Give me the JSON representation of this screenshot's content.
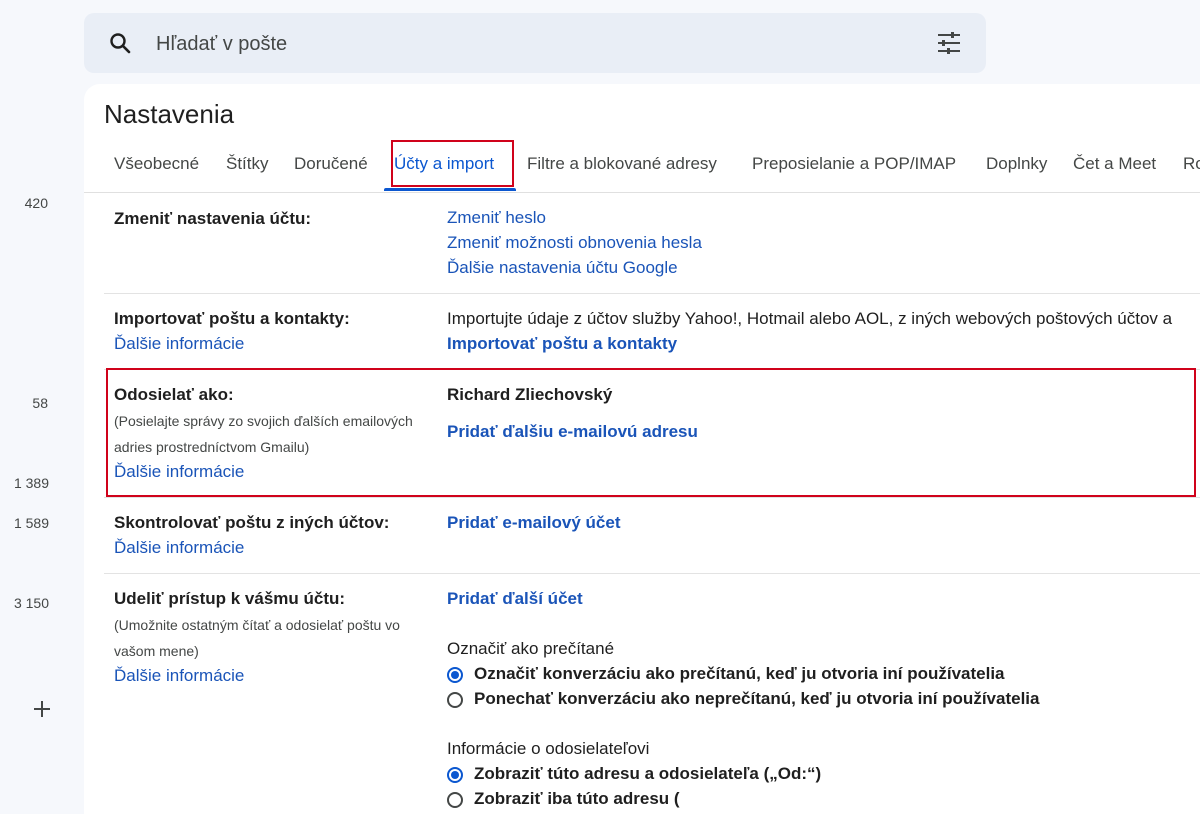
{
  "left_rail": {
    "counts": [
      "420",
      "58",
      "1 389",
      "1 589",
      "3 150"
    ]
  },
  "search": {
    "placeholder": "Hľadať v pošte"
  },
  "settings": {
    "title": "Nastavenia",
    "tabs": [
      {
        "label": "Všeobecné"
      },
      {
        "label": "Štítky"
      },
      {
        "label": "Doručené"
      },
      {
        "label": "Účty a import",
        "active": true
      },
      {
        "label": "Filtre a blokované adresy"
      },
      {
        "label": "Preposielanie a POP/IMAP"
      },
      {
        "label": "Doplnky"
      },
      {
        "label": "Čet a Meet"
      },
      {
        "label": "Ro"
      }
    ],
    "sections": {
      "change_account": {
        "label": "Zmeniť nastavenia účtu:",
        "links": [
          "Zmeniť heslo",
          "Zmeniť možnosti obnovenia hesla",
          "Ďalšie nastavenia účtu Google"
        ]
      },
      "import": {
        "label": "Importovať poštu a kontakty:",
        "learn_more": "Ďalšie informácie",
        "description": "Importujte údaje z účtov služby Yahoo!, Hotmail alebo AOL, z iných webových poštových účtov a",
        "action": "Importovať poštu a kontakty"
      },
      "send_as": {
        "label": "Odosielať ako:",
        "note_line1": "(Posielajte správy zo svojich ďalších emailových",
        "note_line2": "adries prostredníctvom Gmailu)",
        "learn_more": "Ďalšie informácie",
        "name": "Richard Zliechovský",
        "action": "Pridať ďalšiu e-mailovú adresu"
      },
      "check_mail": {
        "label": "Skontrolovať poštu z iných účtov:",
        "learn_more": "Ďalšie informácie",
        "action": "Pridať e-mailový účet"
      },
      "grant_access": {
        "label": "Udeliť prístup k vášmu účtu:",
        "note_line1": "(Umožnite ostatným čítať a odosielať poštu vo",
        "note_line2": "vašom mene)",
        "learn_more": "Ďalšie informácie",
        "action": "Pridať ďalší účet",
        "mark_read_heading": "Označiť ako prečítané",
        "mark_read_options": [
          "Označiť konverzáciu ako prečítanú, keď ju otvoria iní používatelia",
          "Ponechať konverzáciu ako neprečítanú, keď ju otvoria iní používatelia"
        ],
        "sender_info_heading": "Informácie o odosielateľovi",
        "sender_info_options": [
          "Zobraziť túto adresu a odosielateľa („Od:“)",
          "Zobraziť iba túto adresu ("
        ]
      }
    }
  },
  "colors": {
    "accent": "#0b57d0",
    "link": "#1a54b8",
    "highlight_box": "#d0021b"
  },
  "icons": [
    "search-icon",
    "tune-icon",
    "plus-icon"
  ]
}
